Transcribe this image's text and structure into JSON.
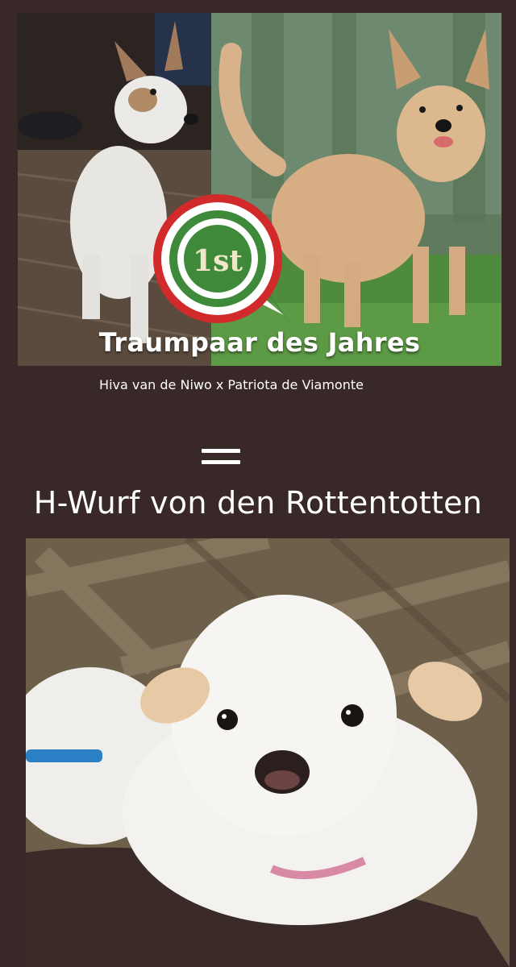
{
  "hero": {
    "banner_text": "Traumpaar des Jahres",
    "rosette_text": "1st"
  },
  "parents_caption": "Hiva van de Niwo x Patriota de Viamonte",
  "equals_symbol": "=",
  "litter_title": "H-Wurf von den Rottentotten",
  "colors": {
    "background": "#382827",
    "text": "#ffffff",
    "rosette_green": "#3f8a3a",
    "rosette_red": "#d22a2a"
  }
}
